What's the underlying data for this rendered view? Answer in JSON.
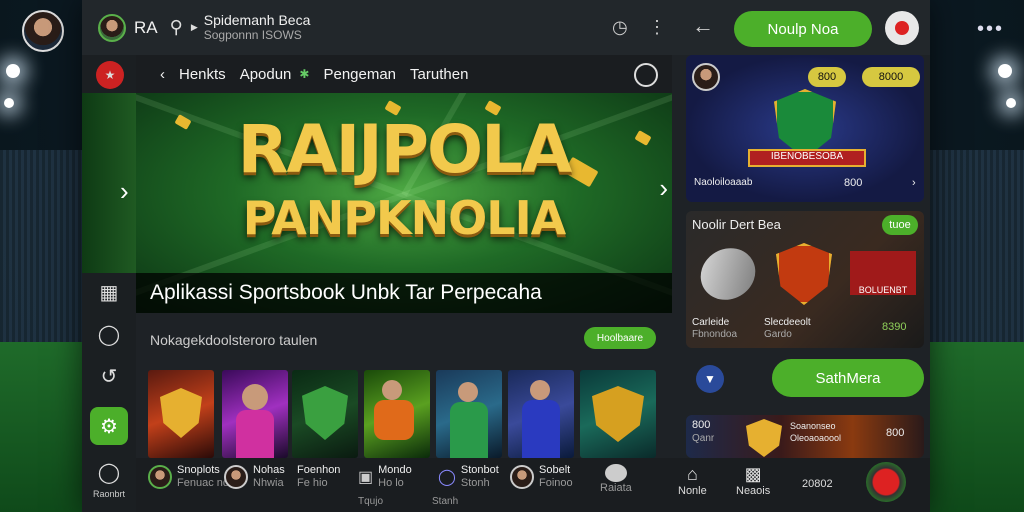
{
  "header": {
    "brand": "RA",
    "title": "Spidemanh Beca",
    "subtitle": "Sogponnn ISOWS",
    "login_label": "Noulp Noa"
  },
  "nav": {
    "items": [
      "Henkts",
      "Apodun",
      "Pengeman",
      "Taruthen"
    ]
  },
  "hero": {
    "title_line1": "RAIJPOLA",
    "title_line2": "PANPKNOLIA",
    "caption": "Aplikassi Sportsbook Unbk Tar Perpecaha"
  },
  "section": {
    "title": "Nokagekdoolsteroro taulen",
    "button_label": "Hoolbaare"
  },
  "rail": {
    "bottom_label": "Raonbrt"
  },
  "bottom_bar": {
    "items": [
      {
        "a": "Snoplots",
        "b": "Fenuac nde"
      },
      {
        "a": "Nohas",
        "b": "Nhwia"
      },
      {
        "a": "Foenhon",
        "b": "Fe hio"
      },
      {
        "a": "Mondo",
        "b": "Ho lo"
      },
      {
        "a": "Stonbot",
        "b": "Stonh"
      },
      {
        "a": "Sobelt",
        "b": "Foinoo"
      },
      {
        "a": "",
        "b": "Raiata"
      }
    ],
    "sub_labels": [
      "Tqujo",
      "Stanh"
    ]
  },
  "right": {
    "card1": {
      "pill1": "800",
      "pill2": "8000",
      "banner": "IBENOBESOBA",
      "footer_left": "Naoloiloaaab",
      "footer_right": "800"
    },
    "card2": {
      "title": "Noolir Dert Bea",
      "pill": "tuoe",
      "label_left": "Carleide",
      "label_left2": "Fbnondoa",
      "label_mid": "Slecdeeolt",
      "label_mid2": "Gardo",
      "label_right": "8390",
      "brand": "BOLUENBT"
    },
    "card3": {
      "button_label": "SathMera"
    },
    "card4": {
      "left": "800",
      "left2": "Qanr",
      "mid": "Soanonseo",
      "mid2": "Oleoaoaoool",
      "right": "800"
    },
    "nav": [
      {
        "label": "Nonle"
      },
      {
        "label": "Neaois"
      },
      {
        "label": "20802"
      }
    ]
  }
}
